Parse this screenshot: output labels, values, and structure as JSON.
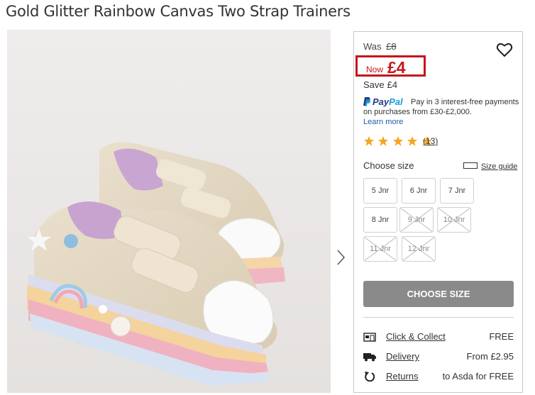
{
  "product": {
    "title": "Gold Glitter Rainbow Canvas Two Strap Trainers"
  },
  "gallery": {
    "next_icon": "chevron-right-icon"
  },
  "price": {
    "was_label": "Was",
    "was_price": "£8",
    "now_label": "Now",
    "now_price": "£4",
    "save_label": "Save",
    "save_amount": "£4",
    "highlight_color": "#c4161c"
  },
  "paypal": {
    "brand_pay": "Pay",
    "brand_pal": "Pal",
    "text_line1": "Pay in 3 interest-free payments",
    "text_line2": "on purchases from £30-£2,000.",
    "learn_more": "Learn more"
  },
  "rating": {
    "stars": 5,
    "count": "13",
    "star_color": "#f5a623"
  },
  "sizes": {
    "heading": "Choose size",
    "guide_label": "Size guide",
    "options": [
      {
        "label": "5 Jnr",
        "available": true
      },
      {
        "label": "6 Jnr",
        "available": true
      },
      {
        "label": "7 Jnr",
        "available": true
      },
      {
        "label": "8 Jnr",
        "available": true
      },
      {
        "label": "9 Jnr",
        "available": false
      },
      {
        "label": "10 Jnr",
        "available": false
      },
      {
        "label": "11 Jnr",
        "available": false
      },
      {
        "label": "12 Jnr",
        "available": false
      }
    ]
  },
  "cta": {
    "label": "CHOOSE SIZE"
  },
  "delivery": [
    {
      "icon": "store-icon",
      "label": "Click & Collect",
      "value": "FREE"
    },
    {
      "icon": "truck-icon",
      "label": "Delivery",
      "value": "From £2.95"
    },
    {
      "icon": "returns-icon",
      "label": "Returns",
      "value": "to Asda for FREE"
    }
  ]
}
